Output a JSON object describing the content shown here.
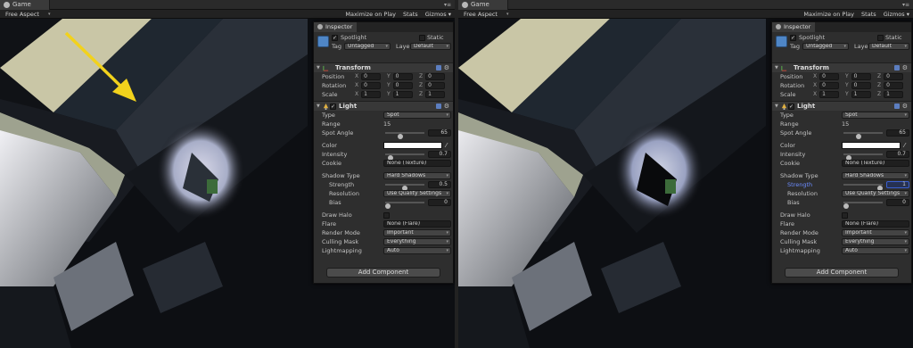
{
  "game_tab": {
    "label": "Game",
    "menu_glyph": "▾≡"
  },
  "toolbar": {
    "aspect": "Free Aspect",
    "maximize": "Maximize on Play",
    "stats": "Stats",
    "gizmos": "Gizmos ▾"
  },
  "inspector": {
    "tab_label": "Inspector",
    "object_name": "Spotlight",
    "static_label": "Static",
    "tag_label": "Tag",
    "tag_value": "Untagged",
    "layer_label": "Layer",
    "layer_value": "Default",
    "transform": {
      "title": "Transform",
      "position_label": "Position",
      "rotation_label": "Rotation",
      "scale_label": "Scale",
      "x": "X",
      "y": "Y",
      "z": "Z",
      "position": [
        "0",
        "0",
        "0"
      ],
      "rotation": [
        "0",
        "0",
        "0"
      ],
      "scale": [
        "1",
        "1",
        "1"
      ]
    },
    "light": {
      "title": "Light",
      "type_label": "Type",
      "type_value": "Spot",
      "range_label": "Range",
      "range_value": "15",
      "spot_angle_label": "Spot Angle",
      "spot_angle_value": "65",
      "spot_angle_fraction": 0.38,
      "color_label": "Color",
      "color_value": "#ffffff",
      "intensity_label": "Intensity",
      "intensity_value": "0.7",
      "intensity_fraction": 0.09,
      "cookie_label": "Cookie",
      "cookie_value": "None (Texture)",
      "shadow_type_label": "Shadow Type",
      "shadow_type_value": "Hard Shadows",
      "strength_label": "Strength",
      "resolution_label": "Resolution",
      "resolution_value": "Use Quality Settings",
      "bias_label": "Bias",
      "bias_value": "0",
      "bias_fraction": 0.0,
      "draw_halo_label": "Draw Halo",
      "flare_label": "Flare",
      "flare_value": "None (Flare)",
      "render_mode_label": "Render Mode",
      "render_mode_value": "Important",
      "culling_mask_label": "Culling Mask",
      "culling_mask_value": "Everything",
      "lightmapping_label": "Lightmapping",
      "lightmapping_value": "Auto"
    },
    "add_component_label": "Add Component"
  },
  "left": {
    "strength_value": "0.5",
    "strength_fraction": 0.5
  },
  "right": {
    "strength_value": "1",
    "strength_fraction": 1.0
  },
  "colors": {
    "arrow": "#f2d21c",
    "selection": "#3a5fd0"
  }
}
